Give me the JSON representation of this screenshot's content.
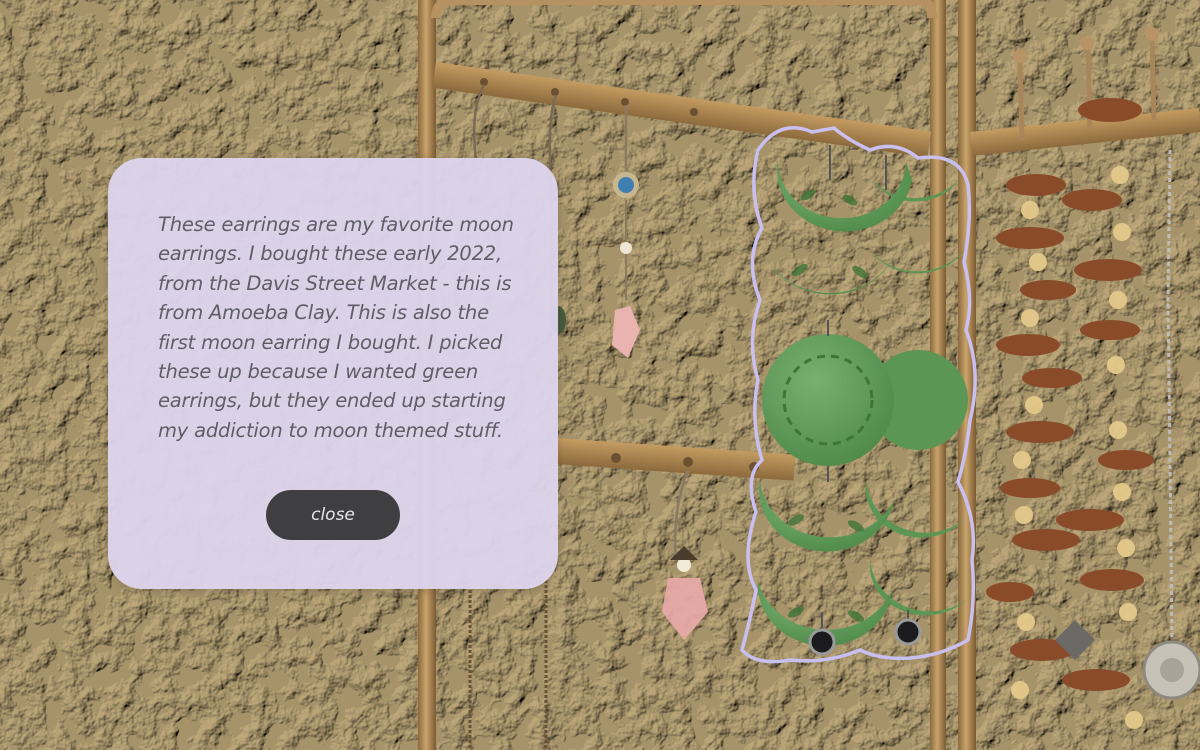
{
  "popup": {
    "description": "These earrings are my favorite moon earrings. I bought these early 2022, from the Davis Street Market - this is from Amoeba Clay. This is also the first moon earring I bought. I picked these up because I wanted green earrings, but they ended up starting my addiction to moon themed stuff.",
    "close_label": "close"
  },
  "colors": {
    "popup_background": "#ddd4ec",
    "popup_text": "#5f5d66",
    "button_background": "#3f3f42",
    "button_text": "#e8e6ee",
    "highlight_outline": "#c9bff0",
    "earring_green": "#5f9a58",
    "wall": "#cdbf9f",
    "brass_stand": "#b08a55"
  }
}
